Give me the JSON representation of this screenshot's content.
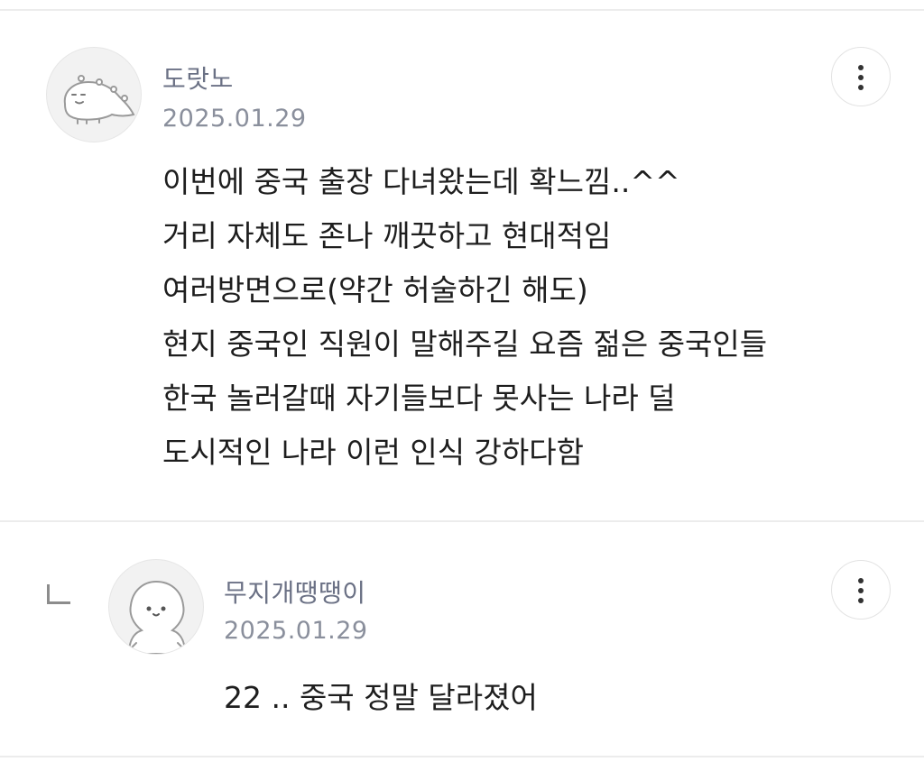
{
  "comments": [
    {
      "username": "도랏노",
      "date": "2025.01.29",
      "avatar_icon": "dinosaur-avatar-icon",
      "lines": [
        "이번에 중국 출장 다녀왔는데 확느낌..^^",
        "거리 자체도 존나 깨끗하고 현대적임",
        "여러방면으로(약간 허술하긴 해도)",
        "현지 중국인 직원이 말해주길 요즘 젊은 중국인들",
        "한국 놀러갈때 자기들보다 못사는 나라 덜",
        "도시적인 나라 이런 인식 강하다함"
      ],
      "more_icon": "more-vertical-icon"
    }
  ],
  "reply": {
    "reply_icon": "reply-arrow-icon",
    "username": "무지개땡땡이",
    "date": "2025.01.29",
    "avatar_icon": "blob-character-avatar-icon",
    "text": "22 .. 중국 정말 달라졌어",
    "more_icon": "more-vertical-icon"
  },
  "colors": {
    "username": "#6b7185",
    "date": "#8a8f9c",
    "body_text": "#1e1e1e",
    "divider": "#ececec"
  }
}
